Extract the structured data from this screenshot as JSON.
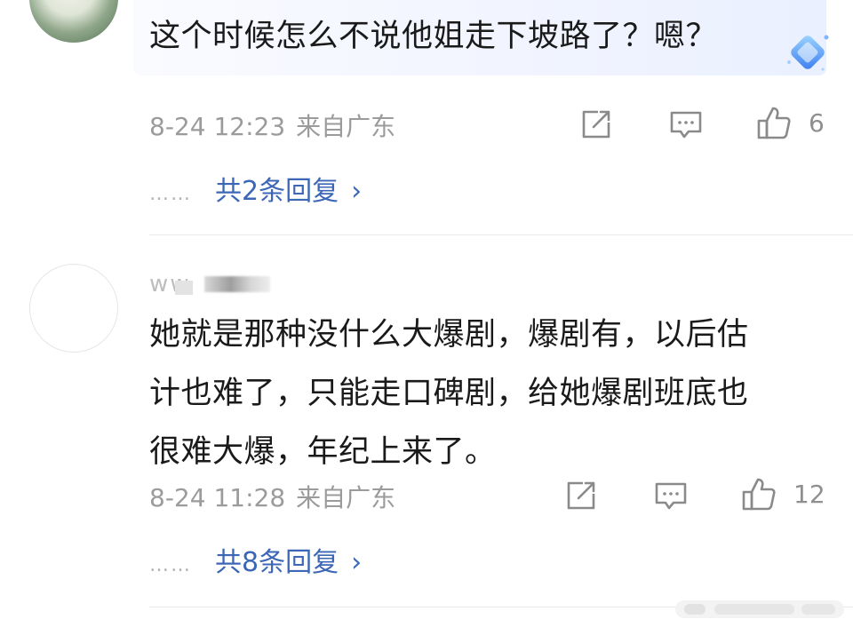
{
  "comments": [
    {
      "text": "这个时候怎么不说他姐走下坡路了？嗯？",
      "time": "8-24 12:23",
      "location": "来自广东",
      "likes": "6",
      "replies_label": "共2条回复",
      "dots": "……",
      "chevron": "›"
    },
    {
      "username": "ww",
      "text": "她就是那种没什么大爆剧，爆剧有，以后估\n计也难了，只能走口碑剧，给她爆剧班底也\n很难大爆，年纪上来了。",
      "time": "8-24 11:28",
      "location": "来自广东",
      "likes": "12",
      "replies_label": "共8条回复",
      "dots": "……",
      "chevron": "›"
    }
  ],
  "icons": {
    "share": "share-icon",
    "comment": "comment-icon",
    "like": "thumbs-up-icon",
    "badge": "diamond-badge-icon"
  },
  "colors": {
    "link": "#3c66b6",
    "meta": "#9b9b9b",
    "bubble": "#eef2ff"
  }
}
